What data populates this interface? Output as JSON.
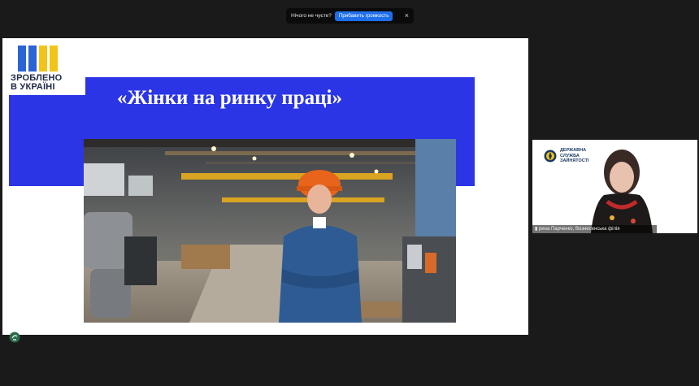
{
  "notification": {
    "message": "Нічого не чуєте?",
    "action_label": "Прибавить громкость",
    "close_glyph": "×"
  },
  "slide": {
    "title": "«Жінки на ринку праці»",
    "logo_line1": "ЗРОБЛЕНО",
    "logo_line2": "В УКРАЇНІ",
    "band_color": "#2b35e6",
    "logo_colors": [
      "#2b64d6",
      "#2b64d6",
      "#f2c417",
      "#f2c417"
    ]
  },
  "participant": {
    "agency_line1": "ДЕРЖАВНА",
    "agency_line2": "СЛУЖБА",
    "agency_line3": "ЗАЙНЯТОСТІ",
    "name_label": "рина Парченко, Вознесенська філія"
  }
}
